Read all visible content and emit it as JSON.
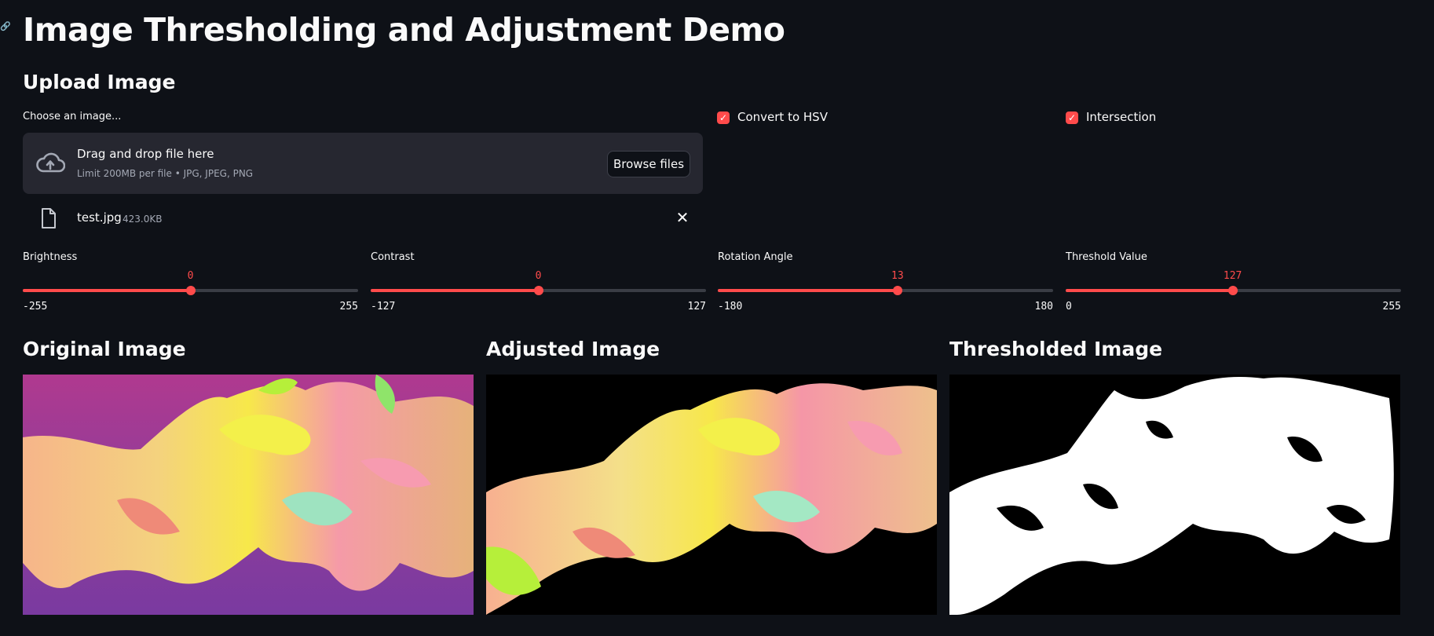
{
  "title": "Image Thresholding and Adjustment Demo",
  "upload": {
    "header": "Upload Image",
    "label": "Choose an image...",
    "drop_title": "Drag and drop file here",
    "drop_sub": "Limit 200MB per file • JPG, JPEG, PNG",
    "browse_label": "Browse files",
    "file_name": "test.jpg",
    "file_size": "423.0KB"
  },
  "checkboxes": [
    {
      "label": "Convert to HSV",
      "checked": true
    },
    {
      "label": "Intersection",
      "checked": true
    }
  ],
  "sliders": [
    {
      "label": "Brightness",
      "value": "0",
      "min": "-255",
      "max": "255",
      "fraction": 0.5
    },
    {
      "label": "Contrast",
      "value": "0",
      "min": "-127",
      "max": "127",
      "fraction": 0.5
    },
    {
      "label": "Rotation Angle",
      "value": "13",
      "min": "-180",
      "max": "180",
      "fraction": 0.536
    },
    {
      "label": "Threshold Value",
      "value": "127",
      "min": "0",
      "max": "255",
      "fraction": 0.498
    }
  ],
  "images": {
    "original_header": "Original Image",
    "adjusted_header": "Adjusted Image",
    "thresholded_header": "Thresholded Image"
  },
  "colors": {
    "background": "#0e1117",
    "accent": "#ff4b4b",
    "panel": "#262730"
  }
}
